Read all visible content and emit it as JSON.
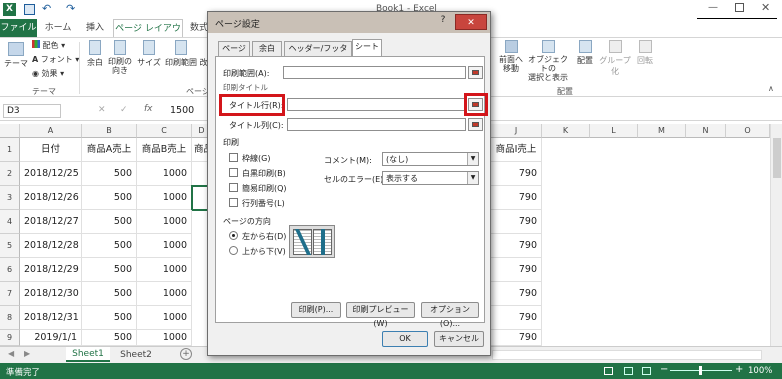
{
  "window": {
    "title": "Book1 - Excel"
  },
  "ribbon_tabs": [
    "ファイル",
    "ホーム",
    "挿入",
    "ページ レイアウト",
    "数式"
  ],
  "ribbon": {
    "theme_label": "テーマ",
    "colors": "配色",
    "fonts": "フォント",
    "effects": "効果",
    "group_theme": "テーマ",
    "margins": "余白",
    "orientation": "印刷の\n向き",
    "size": "サイズ",
    "print_area": "印刷範囲",
    "breaks": "改",
    "group_page_setup": "ページ設定",
    "bring_forward": "前面へ\n移動",
    "selection_pane": "オブジェクトの\n選択と表示",
    "align": "配置",
    "group": "グループ化",
    "rotate": "回転",
    "group_arrange": "配置"
  },
  "formula_bar": {
    "name_box": "D3",
    "value": "1500",
    "fx": "fx"
  },
  "grid": {
    "columns": [
      "A",
      "B",
      "C",
      "D",
      "J",
      "K",
      "L",
      "M",
      "N",
      "O"
    ],
    "rows": [
      "1",
      "2",
      "3",
      "4",
      "5",
      "6",
      "7",
      "8",
      "9"
    ],
    "header_row": {
      "a": "日付",
      "b": "商品A売上",
      "c": "商品B売上",
      "d": "商品",
      "j": "商品I売上"
    },
    "data": [
      {
        "a": "2018/12/25",
        "b": "500",
        "c": "1000",
        "j": "790"
      },
      {
        "a": "2018/12/26",
        "b": "500",
        "c": "1000",
        "j": "790"
      },
      {
        "a": "2018/12/27",
        "b": "500",
        "c": "1000",
        "j": "790"
      },
      {
        "a": "2018/12/28",
        "b": "500",
        "c": "1000",
        "j": "790"
      },
      {
        "a": "2018/12/29",
        "b": "500",
        "c": "1000",
        "j": "790"
      },
      {
        "a": "2018/12/30",
        "b": "500",
        "c": "1000",
        "j": "790"
      },
      {
        "a": "2018/12/31",
        "b": "500",
        "c": "1000",
        "j": "790"
      },
      {
        "a": "2019/1/1",
        "b": "500",
        "c": "1000",
        "j": "790"
      }
    ]
  },
  "sheets": [
    "Sheet1",
    "Sheet2"
  ],
  "status": {
    "ready": "準備完了",
    "zoom": "100%"
  },
  "dialog": {
    "title": "ページ設定",
    "help": "?",
    "close": "✕",
    "tabs": [
      "ページ",
      "余白",
      "ヘッダー/フッター",
      "シート"
    ],
    "print_area_label": "印刷範囲(A):",
    "print_titles_label": "印刷タイトル",
    "title_rows_label": "タイトル行(R):",
    "title_cols_label": "タイトル列(C):",
    "print_section": "印刷",
    "gridlines": "枠線(G)",
    "black_white": "白黒印刷(B)",
    "draft": "簡易印刷(Q)",
    "row_col_headings": "行列番号(L)",
    "comments_label": "コメント(M):",
    "comments_value": "(なし)",
    "cell_errors_label": "セルのエラー(E):",
    "cell_errors_value": "表示する",
    "page_order": "ページの方向",
    "down_then_over": "左から右(D)",
    "over_then_down": "上から下(V)",
    "print_btn": "印刷(P)...",
    "preview_btn": "印刷プレビュー(W)",
    "options_btn": "オプション(O)...",
    "ok": "OK",
    "cancel": "キャンセル"
  }
}
